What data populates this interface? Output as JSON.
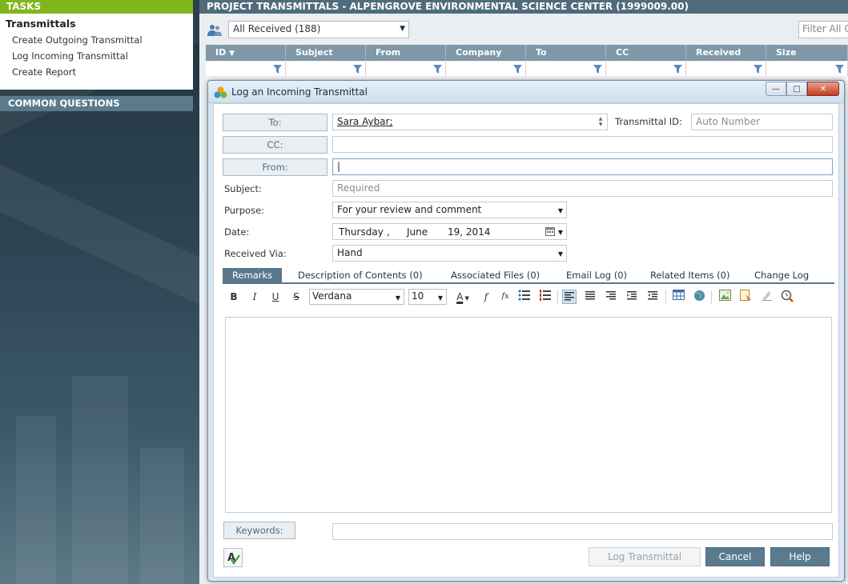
{
  "left": {
    "tasks_header": "TASKS",
    "section": "Transmittals",
    "links": [
      "Create Outgoing Transmittal",
      "Log Incoming Transmittal",
      "Create Report"
    ],
    "common_questions": "COMMON QUESTIONS"
  },
  "main": {
    "title": "PROJECT TRANSMITTALS - ALPENGROVE ENVIRONMENTAL SCIENCE CENTER (1999009.00)",
    "view_select": "All Received (188)",
    "filter_placeholder": "Filter All C",
    "columns": [
      "ID",
      "Subject",
      "From",
      "Company",
      "To",
      "CC",
      "Received",
      "Size"
    ]
  },
  "dialog": {
    "title": "Log an Incoming Transmittal",
    "to_label": "To:",
    "to_value": "Sara Aybar;",
    "transmittal_id_label": "Transmittal ID:",
    "transmittal_id_placeholder": "Auto Number",
    "cc_label": "CC:",
    "from_label": "From:",
    "from_value": "|",
    "subject_label": "Subject:",
    "subject_placeholder": "Required",
    "purpose_label": "Purpose:",
    "purpose_value": "For your review and comment",
    "date_label": "Date:",
    "date_day": "Thursday",
    "date_sep": ",",
    "date_month": "June",
    "date_day_year": "19, 2014",
    "received_via_label": "Received Via:",
    "received_via_value": "Hand",
    "tabs": [
      "Remarks",
      "Description of Contents (0)",
      "Associated Files (0)",
      "Email Log (0)",
      "Related Items (0)",
      "Change Log"
    ],
    "toolbar": {
      "bold": "B",
      "italic": "I",
      "underline": "U",
      "strike": "S",
      "font": "Verdana",
      "size": "10",
      "font_color": "A",
      "func": "f",
      "fx": "fx"
    },
    "keywords_label": "Keywords:",
    "buttons": {
      "log": "Log Transmittal",
      "cancel": "Cancel",
      "help": "Help"
    }
  },
  "colors": {
    "tasks_green": "#7fb61c",
    "title_bar": "#4f6b7c",
    "grid_header": "#7f97a6",
    "accent": "#59788c"
  }
}
